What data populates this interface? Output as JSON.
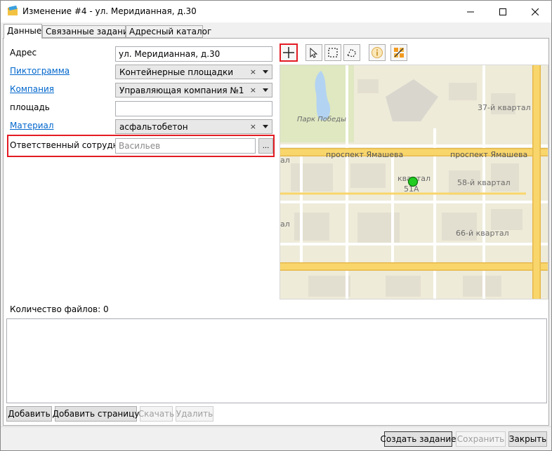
{
  "window": {
    "title": "Изменение #4 - ул. Меридианная, д.30",
    "minimize": "–",
    "maximize": "☐",
    "close": "✕"
  },
  "tabs": [
    {
      "label": "Данные",
      "active": true
    },
    {
      "label": "Связанные задания",
      "active": false
    },
    {
      "label": "Адресный каталог",
      "active": false
    }
  ],
  "form": {
    "address_label": "Адрес",
    "address_value": "ул. Меридианная, д.30",
    "pictogram_label": "Пиктограмма",
    "pictogram_value": "Контейнерные площадки",
    "company_label": "Компания",
    "company_value": "Управляющая компания №1",
    "area_label": "площадь",
    "area_value": "",
    "material_label": "Материал",
    "material_value": "асфальтобетон",
    "responsible_label": "Ответственный сотрудник",
    "responsible_placeholder": "Васильев",
    "browse_label": "...",
    "clear_glyph": "×"
  },
  "map": {
    "labels": {
      "park": "Парк Победы",
      "kvartal37": "37-й квартал",
      "prospect_left": "проспект Ямашева",
      "prospect_right": "проспект Ямашева",
      "kvartal": "квартал",
      "kvartal51": "51А",
      "kvartal58": "58-й квартал",
      "kvartal66": "66-й квартал",
      "edge_left_top": "ал",
      "edge_left_bottom": "ал"
    },
    "marker_color": "#22cc22",
    "colors": {
      "background": "#eeebd9",
      "major_road": "#f9d66b",
      "minor_road": "#ffffff",
      "water": "#b3d3f2",
      "park": "#dfe8c1",
      "block": "#e3dfd0"
    }
  },
  "files": {
    "count_label": "Количество файлов: 0"
  },
  "buttons": {
    "add": "Добавить",
    "add_page": "Добавить страницу",
    "download": "Скачать",
    "delete": "Удалить",
    "create_task": "Создать задание",
    "save": "Сохранить",
    "close": "Закрыть"
  }
}
